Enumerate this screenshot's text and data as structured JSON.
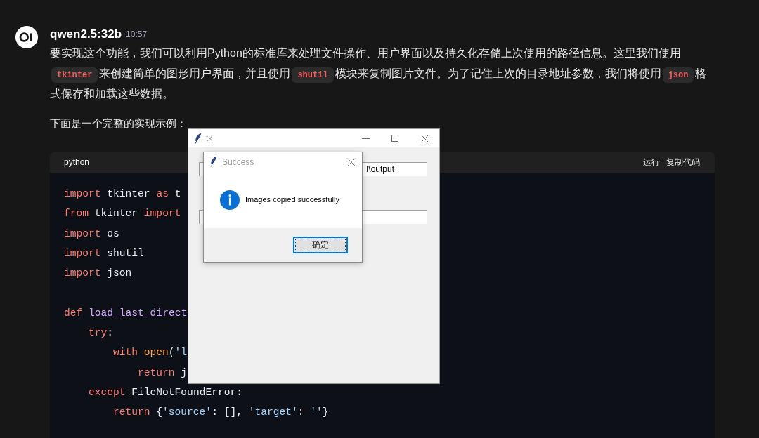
{
  "message": {
    "author": "qwen2.5:32b",
    "time": "10:57",
    "paragraphs": [
      {
        "segments": [
          {
            "kind": "text",
            "text": "要实现这个功能，我们可以利用Python的标准库来处理文件操作、用户界面以及持久化存储上次使用的路径信息。这里我们使用"
          },
          {
            "kind": "code",
            "text": "tkinter"
          },
          {
            "kind": "text",
            "text": "来创建简单的图形用户界面，并且使用"
          },
          {
            "kind": "code",
            "text": "shutil"
          },
          {
            "kind": "text",
            "text": "模块来复制图片文件。为了记住上次的目录地址参数，我们将使用"
          },
          {
            "kind": "code",
            "text": "json"
          },
          {
            "kind": "text",
            "text": "格式保存和加载这些数据。"
          }
        ]
      },
      {
        "segments": [
          {
            "kind": "text",
            "text": "下面是一个完整的实现示例："
          }
        ]
      }
    ]
  },
  "code_block": {
    "language": "python",
    "actions": [
      "运行",
      "复制代码"
    ],
    "lines": [
      {
        "tokens": [
          {
            "kind": "keyword",
            "text": "import"
          },
          {
            "kind": "plain",
            "text": " tkinter "
          },
          {
            "kind": "keyword",
            "text": "as"
          },
          {
            "kind": "plain",
            "text": " t"
          }
        ]
      },
      {
        "tokens": [
          {
            "kind": "keyword",
            "text": "from"
          },
          {
            "kind": "plain",
            "text": " tkinter "
          },
          {
            "kind": "keyword",
            "text": "import"
          }
        ]
      },
      {
        "tokens": [
          {
            "kind": "keyword",
            "text": "import"
          },
          {
            "kind": "plain",
            "text": " os"
          }
        ]
      },
      {
        "tokens": [
          {
            "kind": "keyword",
            "text": "import"
          },
          {
            "kind": "plain",
            "text": " shutil"
          }
        ]
      },
      {
        "tokens": [
          {
            "kind": "keyword",
            "text": "import"
          },
          {
            "kind": "plain",
            "text": " json"
          }
        ]
      },
      {
        "blank_line_before": true,
        "tokens": [
          {
            "kind": "keyword",
            "text": "def"
          },
          {
            "kind": "function",
            "text": " load_last_direct"
          }
        ],
        "children": [
          {
            "tokens": [
              {
                "kind": "keyword",
                "text": "try"
              },
              {
                "kind": "plain",
                "text": ":"
              }
            ],
            "children": [
              {
                "tokens": [
                  {
                    "kind": "keyword",
                    "text": "with"
                  },
                  {
                    "kind": "builtin",
                    "text": " open"
                  },
                  {
                    "kind": "plain",
                    "text": "("
                  },
                  {
                    "kind": "string",
                    "text": "'l"
                  }
                ],
                "children": [
                  {
                    "tokens": [
                      {
                        "kind": "keyword",
                        "text": "return"
                      },
                      {
                        "kind": "plain",
                        "text": " j"
                      }
                    ]
                  }
                ]
              }
            ]
          },
          {
            "tokens": [
              {
                "kind": "keyword",
                "text": "except"
              },
              {
                "kind": "plain",
                "text": " FileNotFoundError:"
              }
            ],
            "children": [
              {
                "tokens": [
                  {
                    "kind": "keyword",
                    "text": "return"
                  },
                  {
                    "kind": "plain",
                    "text": " {"
                  },
                  {
                    "kind": "string",
                    "text": "'source'"
                  },
                  {
                    "kind": "plain",
                    "text": ": [], "
                  },
                  {
                    "kind": "string",
                    "text": "'target'"
                  },
                  {
                    "kind": "plain",
                    "text": ": "
                  },
                  {
                    "kind": "string",
                    "text": "''"
                  },
                  {
                    "kind": "plain",
                    "text": "}"
                  }
                ]
              }
            ]
          }
        ]
      }
    ]
  },
  "tk_window": {
    "title": "tk",
    "entries": [
      {
        "kind": "entry",
        "text": "I\\output"
      },
      {
        "kind": "entry"
      }
    ]
  },
  "dialog": {
    "title": "Success",
    "message": "Images copied successfully",
    "buttons": [
      {
        "label": "确定",
        "focused": true
      }
    ]
  }
}
